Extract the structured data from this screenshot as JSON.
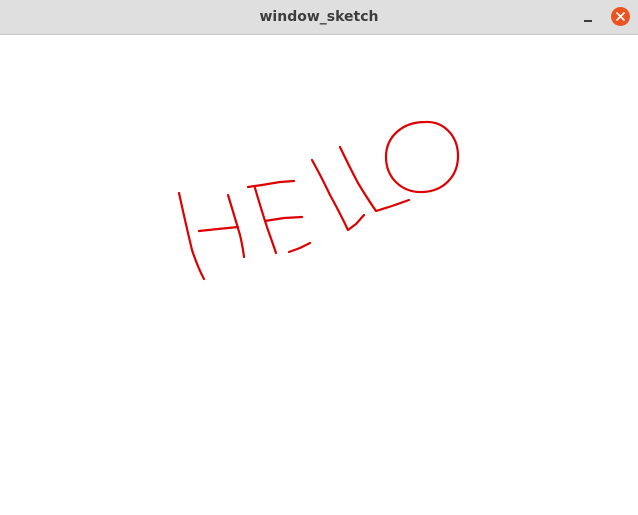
{
  "window": {
    "title": "window_sketch",
    "controls": {
      "minimize_icon": "minimize-icon",
      "close_icon": "close-icon",
      "close_color": "#e95420"
    }
  },
  "canvas": {
    "background": "#ffffff",
    "stroke_color": "#dd0000",
    "drawing_description": "freehand HELLO"
  }
}
